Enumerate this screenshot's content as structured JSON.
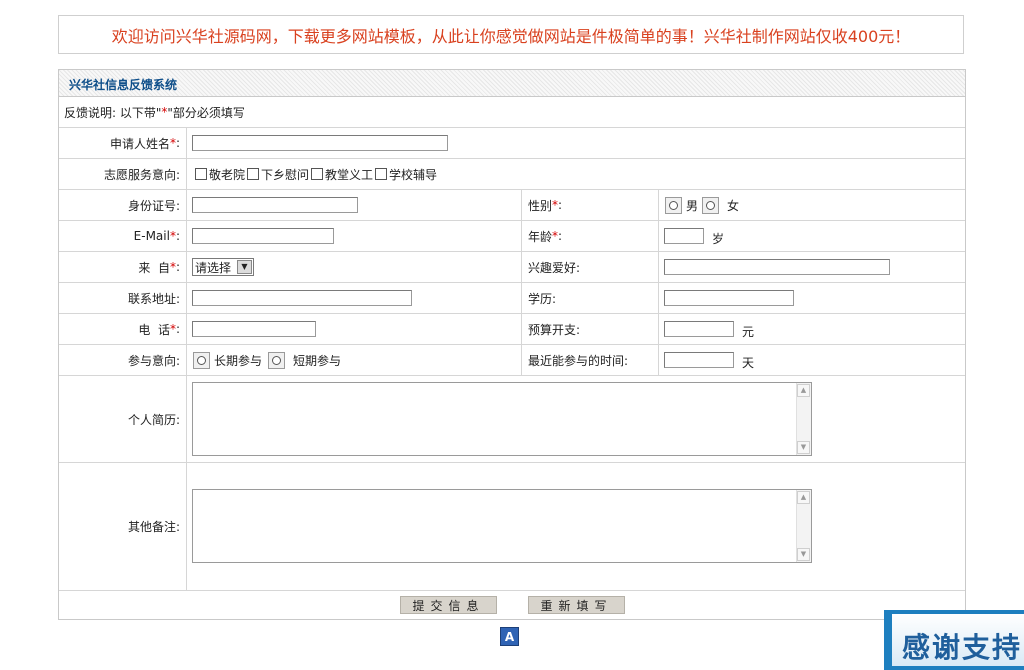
{
  "banner": {
    "text": "欢迎访问兴华社源码网，下载更多网站模板，从此让你感觉做网站是件极简单的事！兴华社制作网站仅收400元！",
    "color": "#d9411f"
  },
  "panel": {
    "title": "兴华社信息反馈系统",
    "title_color": "#0f4f8a"
  },
  "note": {
    "prefix": "反馈说明: 以下带\"",
    "star": "*",
    "suffix": "\"部分必须填写"
  },
  "form": {
    "name_label": "申请人姓名",
    "star": "*",
    "colon": ":",
    "service_label": "志愿服务意向:",
    "service_options": [
      "敬老院",
      "下乡慰问",
      "教堂义工",
      "学校辅导"
    ],
    "id_label": "身份证号:",
    "gender_label": "性别",
    "gender_male": "男",
    "gender_female": "女",
    "email_label": "E-Mail",
    "age_label": "年龄",
    "age_unit": "岁",
    "from_label": "来  自",
    "from_select": "请选择",
    "hobby_label": "兴趣爱好:",
    "address_label": "联系地址:",
    "edu_label": "学历:",
    "phone_label": "电  话",
    "budget_label": "预算开支:",
    "budget_unit": "元",
    "join_label": "参与意向:",
    "join_long": "长期参与",
    "join_short": "短期参与",
    "time_label": "最近能参与的时间:",
    "time_unit": "天",
    "resume_label": "个人简历:",
    "remark_label": "其他备注:"
  },
  "buttons": {
    "submit": "提交信息",
    "reset": "重新填写"
  },
  "footer": {
    "icon": "A",
    "thanks": "感谢支持"
  }
}
